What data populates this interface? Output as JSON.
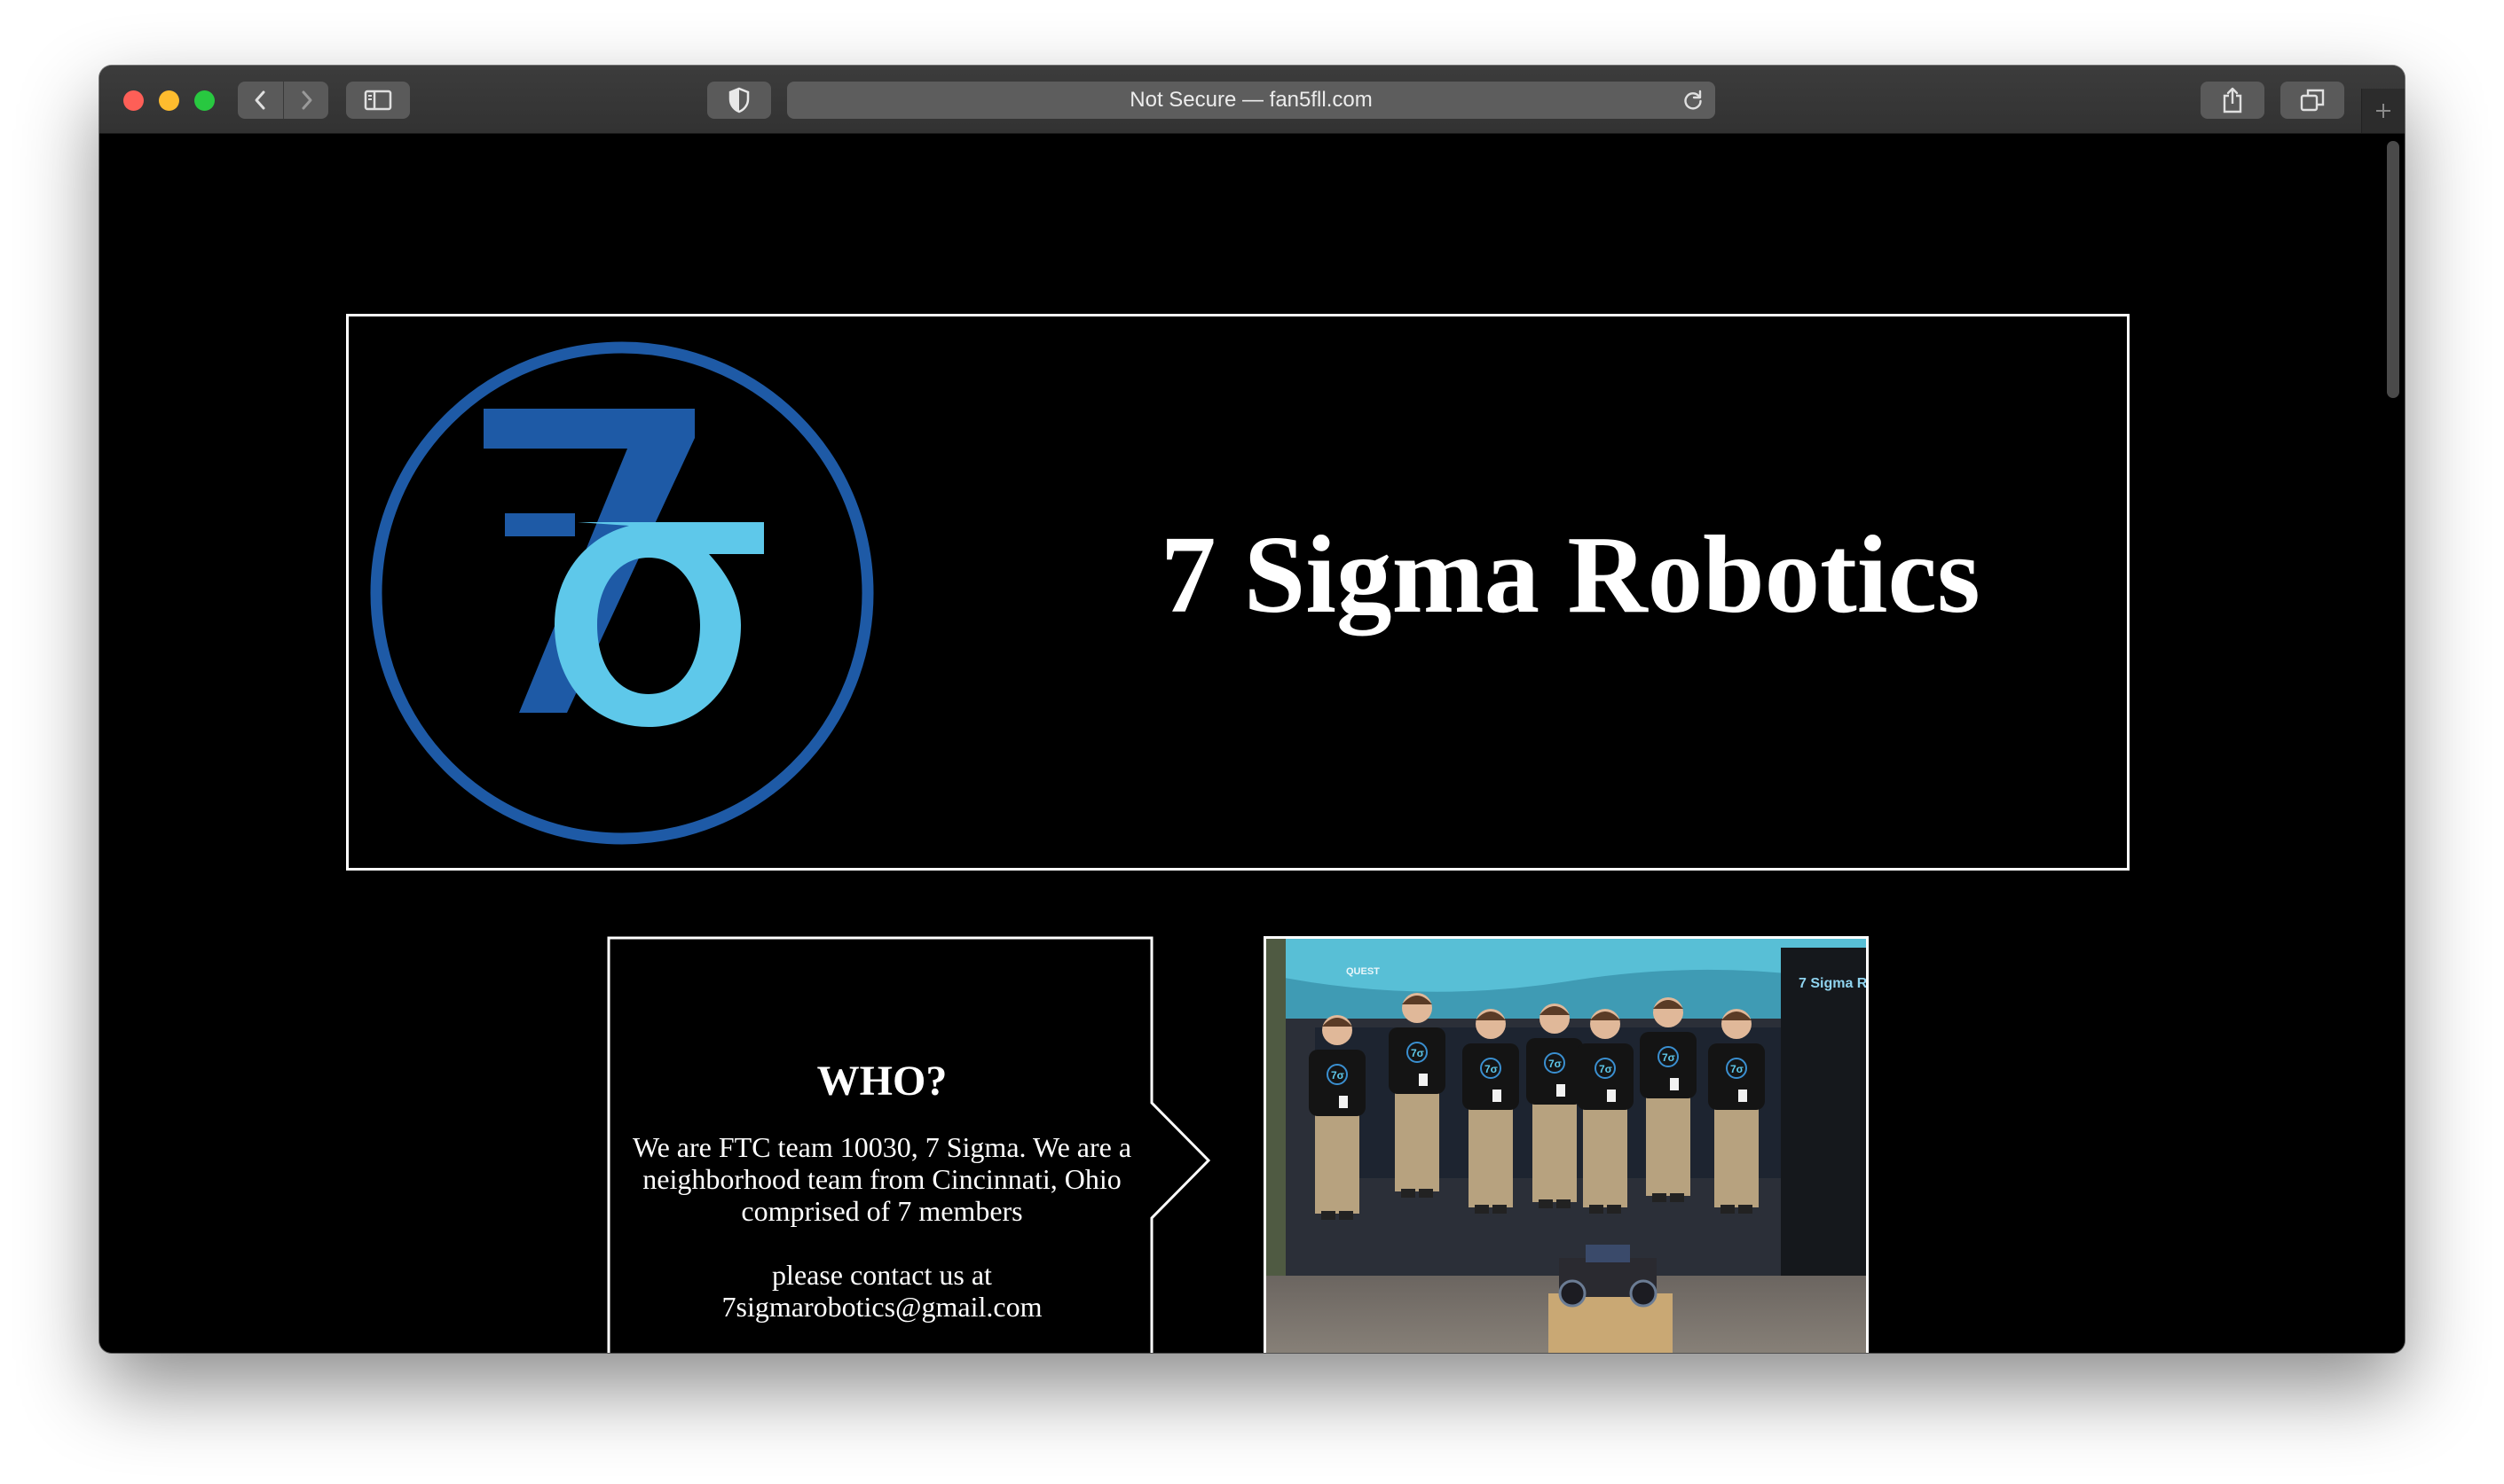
{
  "browser": {
    "address": "Not Secure — fan5fll.com",
    "colors": {
      "close": "#fe5f57",
      "minimize": "#febc2e",
      "zoom": "#28c840"
    }
  },
  "page": {
    "title": "7 Sigma Robotics",
    "logo": {
      "glyphs": "7σ",
      "ring_color": "#1e5aa6",
      "seven_color": "#1e5aa6",
      "sigma_color": "#5ec8ea"
    },
    "who": {
      "heading": "WHO?",
      "text": "We are FTC team 10030, 7 Sigma. We are a neighborhood team from Cincinnati, Ohio comprised of 7 members",
      "contact_line1": "please contact us at",
      "contact_line2": "7sigmarobotics@gmail.com"
    },
    "photo": {
      "banner_text": "7 Sigma R",
      "sign_text": "QUEST",
      "shirt_mark": "7σ",
      "member_count": 7
    }
  }
}
